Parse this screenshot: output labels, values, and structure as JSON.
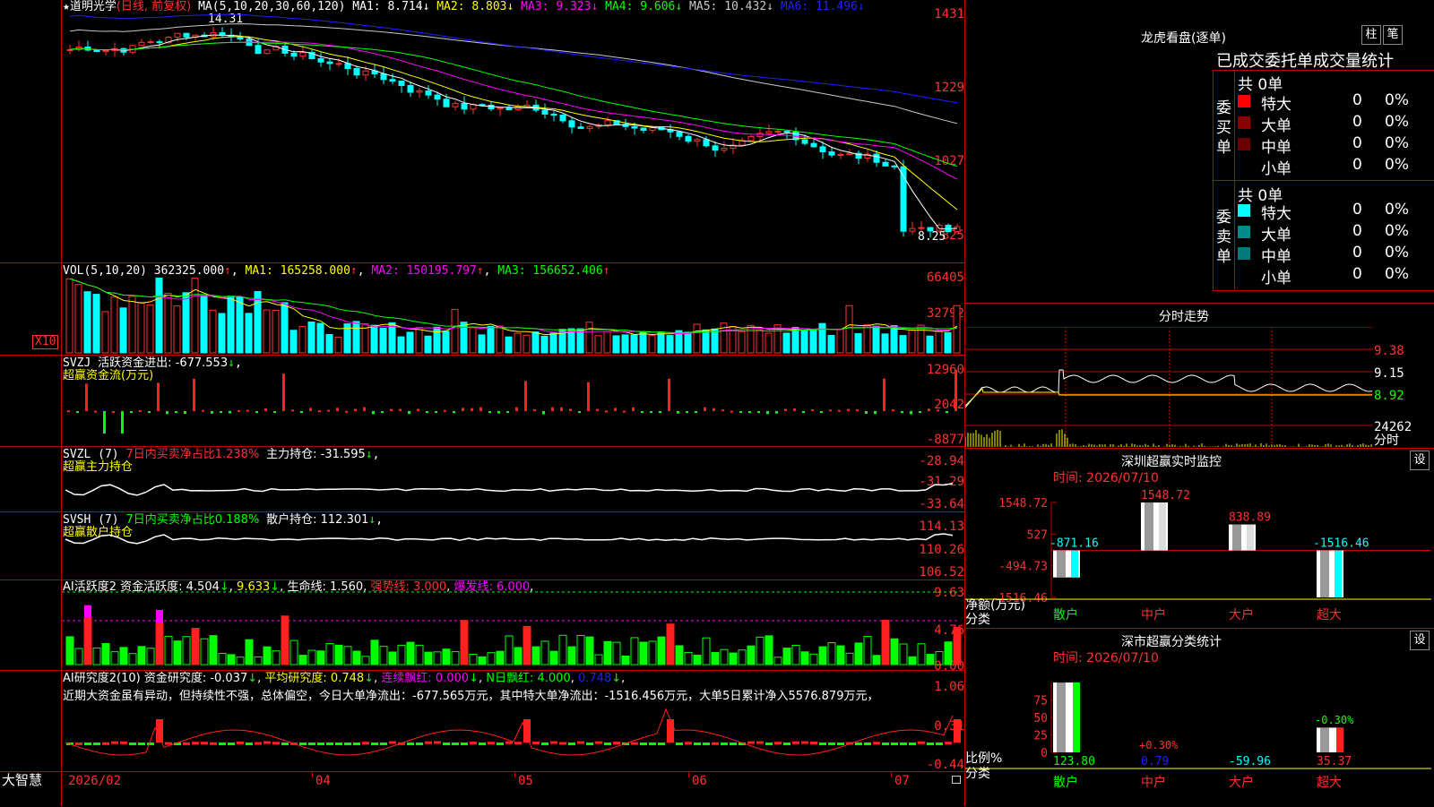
{
  "colors": {
    "up": "#ff3030",
    "down": "#00ffff",
    "ma1": "#ffffff",
    "ma2": "#ffff00",
    "ma3": "#ff00ff",
    "ma4": "#00ff00",
    "ma5": "#c8c8c8",
    "ma6": "#2020ff",
    "grid": "#c00000",
    "green": "#00ff00",
    "yellow": "#ffff00",
    "magenta": "#ff00ff"
  },
  "main": {
    "stock_name": "道明光学",
    "mode": "(日线, 前复权)",
    "ma_label": "MA(5,10,20,30,60,120)",
    "ma": [
      {
        "name": "MA1:",
        "value": "8.714"
      },
      {
        "name": "MA2:",
        "value": "8.803"
      },
      {
        "name": "MA3:",
        "value": "9.323"
      },
      {
        "name": "MA4:",
        "value": "9.606"
      },
      {
        "name": "MA5:",
        "value": "10.432"
      },
      {
        "name": "MA6:",
        "value": "11.496"
      }
    ],
    "high_label": "14.31",
    "low_label": "8.25",
    "y_ticks": [
      "1431",
      "1229",
      "1027",
      "825"
    ]
  },
  "vol": {
    "label": "VOL(5,10,20)",
    "value": "362325.000",
    "ma1": "MA1: 165258.000",
    "ma2": "MA2: 150195.797",
    "ma3": "MA3: 156652.406",
    "y_ticks": [
      "66405",
      "32792"
    ],
    "unit": "X10"
  },
  "svzj": {
    "label": "SVZJ",
    "desc": "活跃资金进出: -677.553",
    "sub": "超赢资金流(万元)",
    "y_ticks": [
      "12960",
      "2042",
      "-8877"
    ]
  },
  "svzl": {
    "label": "SVZL (7)",
    "desc1": "7日内买卖净占比1.238%",
    "desc2": "主力持仓: -31.595",
    "sub": "超赢主力持仓",
    "y_ticks": [
      "-28.94",
      "-31.29",
      "-33.64"
    ]
  },
  "svsh": {
    "label": "SVSH (7)",
    "desc1": "7日内买卖净占比0.188%",
    "desc2": "散户持仓: 112.301",
    "sub": "超赢散户持仓",
    "y_ticks": [
      "114.13",
      "110.26",
      "106.52"
    ]
  },
  "ai_active": {
    "label": "AI活跃度2",
    "d1": "资金活跃度: 4.504",
    "d2": "9.633",
    "d3": "生命线: 1.560",
    "d4": "强势线: 3.000",
    "d5": "爆发线: 6.000",
    "y_ticks": [
      "9.63",
      "4.76",
      "0.00"
    ]
  },
  "ai_research": {
    "label": "AI研究度2(10)",
    "d1": "资金研究度: -0.037",
    "d2": "平均研究度: 0.748",
    "d3": "连续飘红: 0.000",
    "d4": "N日飘红: 4.000",
    "d5": "0.748",
    "comment": "近期大资金虽有异动，但持续性不强，总体偏空，今日大单净流出：-677.565万元，其中特大单净流出：-1516.456万元，大单5日累计净入5576.879万元，",
    "y_ticks": [
      "1.06",
      "0.31",
      "-0.44"
    ]
  },
  "xaxis": {
    "brand": "大智慧",
    "labels": [
      "2026/02",
      "04",
      "05",
      "06",
      "07"
    ]
  },
  "dragon": {
    "title": "龙虎看盘(逐单)",
    "btn1": "柱",
    "btn2": "笔",
    "header": "已成交委托单成交量统计",
    "buy": {
      "side": "委买单",
      "count": "共 0单",
      "rows": [
        {
          "name": "特大",
          "color": "#ff0000",
          "v": "0",
          "p": "0%"
        },
        {
          "name": "大单",
          "color": "#8b0000",
          "v": "0",
          "p": "0%"
        },
        {
          "name": "中单",
          "color": "#6b0000",
          "v": "0",
          "p": "0%"
        },
        {
          "name": "小单",
          "color": "",
          "v": "0",
          "p": "0%"
        }
      ]
    },
    "sell": {
      "side": "委卖单",
      "count": "共 0单",
      "rows": [
        {
          "name": "特大",
          "color": "#00ffff",
          "v": "0",
          "p": "0%"
        },
        {
          "name": "大单",
          "color": "#008b8b",
          "v": "0",
          "p": "0%"
        },
        {
          "name": "中单",
          "color": "#007a7a",
          "v": "0",
          "p": "0%"
        },
        {
          "name": "小单",
          "color": "",
          "v": "0",
          "p": "0%"
        }
      ]
    }
  },
  "intraday": {
    "title": "分时走势",
    "y_ticks": [
      "9.38",
      "9.15",
      "8.92"
    ],
    "vol_label": "24262",
    "vol_unit": "分时"
  },
  "sz_monitor": {
    "title": "深圳超赢实时监控",
    "btn": "设",
    "time": "时间: 2026/07/10",
    "y_ticks": [
      "1548.72",
      "527",
      "-494.73",
      "-1516.46"
    ],
    "ylabel": "净额(万元)",
    "xlabel": "分类",
    "chart_data": {
      "type": "bar",
      "categories": [
        "散户",
        "中户",
        "大户",
        "超大"
      ],
      "values": [
        -871.16,
        1548.72,
        838.89,
        -1516.46
      ],
      "ylim": [
        -1516.46,
        1548.72
      ],
      "ylabel": "净额(万元)",
      "xlabel": "分类"
    }
  },
  "sz_class": {
    "title": "深市超赢分类统计",
    "btn": "设",
    "time": "时间: 2026/07/10",
    "y_ticks": [
      "75",
      "50",
      "25",
      "0"
    ],
    "ylabel": "比例%",
    "xlabel": "分类",
    "pct_labels": [
      "+0.30%",
      "-0.30%"
    ],
    "chart_data": {
      "type": "bar",
      "categories": [
        "散户",
        "中户",
        "大户",
        "超大"
      ],
      "values": [
        123.8,
        0.79,
        -59.96,
        35.37
      ],
      "ylim": [
        0,
        100
      ],
      "ylabel": "比例%",
      "xlabel": "分类"
    }
  }
}
